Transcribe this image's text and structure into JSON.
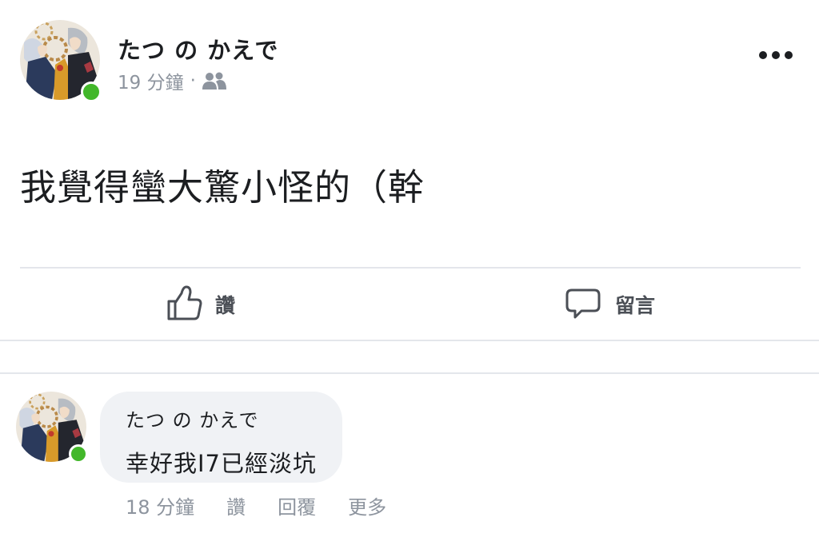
{
  "post": {
    "author": "たつ の かえで",
    "time": "19 分鐘",
    "separator": "·",
    "audience_icon": "friends-icon",
    "more_icon": "more-horizontal-icon",
    "text": "我覺得蠻大驚小怪的（幹",
    "actions": {
      "like_label": "讚",
      "like_icon": "thumbs-up-icon",
      "comment_label": "留言",
      "comment_icon": "comment-icon"
    }
  },
  "comment": {
    "author": "たつ の かえで",
    "text": "幸好我I7已經淡坑",
    "time": "18 分鐘",
    "like_label": "讚",
    "reply_label": "回覆",
    "more_label": "更多"
  },
  "colors": {
    "text_primary": "#1c1e21",
    "text_secondary": "#8d949e",
    "action_text": "#4b4f56",
    "online_green": "#42b72a",
    "bubble_bg": "#f0f2f5",
    "divider": "#e4e6eb"
  }
}
